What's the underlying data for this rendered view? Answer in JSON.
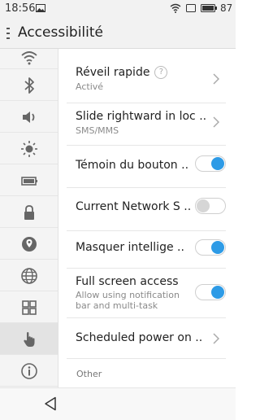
{
  "status": {
    "time": "18:56",
    "battery": "87"
  },
  "app_bar": {
    "title": "Accessibilité"
  },
  "sidebar": {
    "items": [
      {
        "icon": "wifi-icon"
      },
      {
        "icon": "bluetooth-icon"
      },
      {
        "icon": "sound-icon"
      },
      {
        "icon": "brightness-icon"
      },
      {
        "icon": "battery-icon"
      },
      {
        "icon": "lock-icon"
      },
      {
        "icon": "location-icon"
      },
      {
        "icon": "globe-icon"
      },
      {
        "icon": "apps-grid-icon"
      },
      {
        "icon": "hand-icon",
        "active": true
      },
      {
        "icon": "info-icon"
      }
    ]
  },
  "settings": {
    "quick_wake": {
      "label": "Réveil rapide",
      "help": "?",
      "sub": "Activé"
    },
    "slide_rightward": {
      "label": "Slide rightward in loc ..",
      "sub": "SMS/MMS"
    },
    "button_indicator": {
      "label": "Témoin du bouton ..",
      "on": true
    },
    "current_network": {
      "label": "Current Network S ..",
      "on": false
    },
    "smart_hide": {
      "label": "Masquer intellige ..",
      "on": true
    },
    "full_screen": {
      "label": "Full screen access",
      "sub": "Allow using notification bar and multi-task",
      "on": true
    },
    "scheduled_power": {
      "label": "Scheduled power on .."
    }
  },
  "section_other": "Other",
  "colors": {
    "accent": "#2e9be6"
  }
}
